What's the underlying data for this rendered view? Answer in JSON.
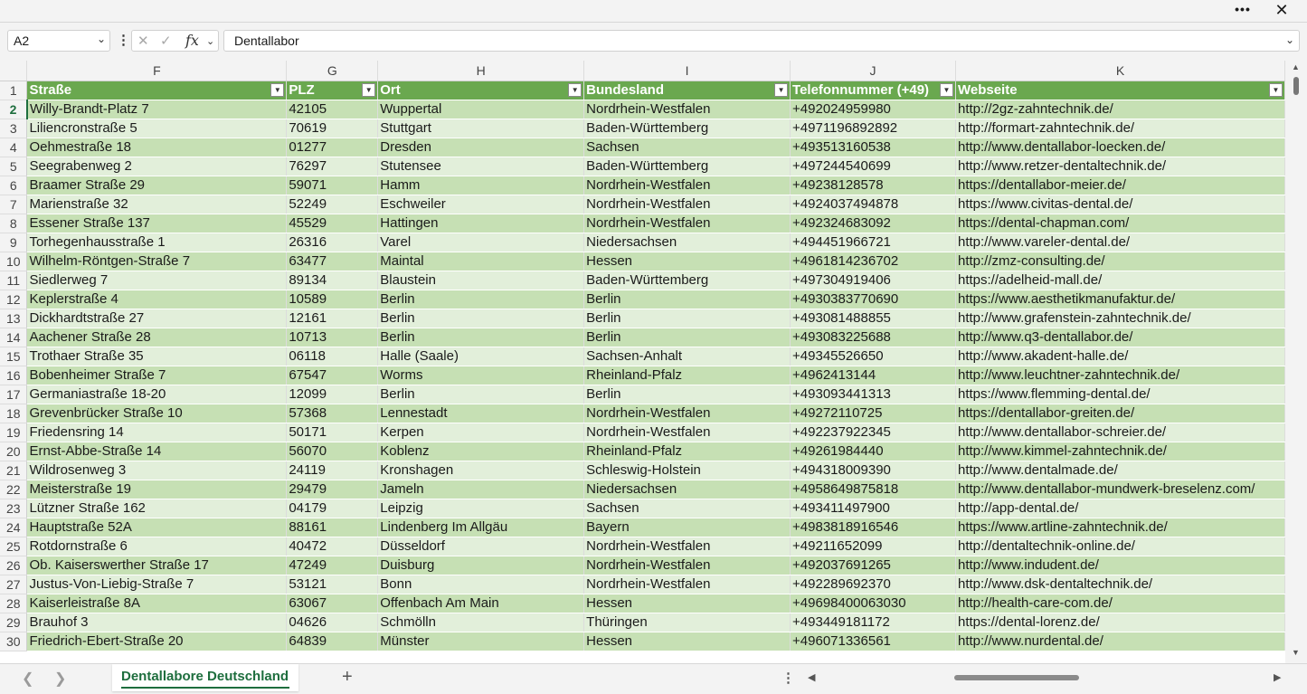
{
  "window": {
    "more_label": "•••",
    "close_label": "✕"
  },
  "formula_bar": {
    "name_box": "A2",
    "chevron": "⌄",
    "dots": "⋮",
    "cancel_icon": "✕",
    "enter_icon": "✓",
    "fx_label": "fx",
    "value": "Dentallabor"
  },
  "columns": [
    "F",
    "G",
    "H",
    "I",
    "J",
    "K"
  ],
  "headers": [
    "Straße",
    "PLZ",
    "Ort",
    "Bundesland",
    "Telefonnummer (+49)",
    "Webseite"
  ],
  "filter_icon": "▼",
  "active_row": "2",
  "rows": [
    {
      "n": "2",
      "cells": [
        "Willy-Brandt-Platz 7",
        "42105",
        "Wuppertal",
        "Nordrhein-Westfalen",
        "+492024959980",
        "http://2gz-zahntechnik.de/"
      ]
    },
    {
      "n": "3",
      "cells": [
        "Liliencronstraße 5",
        "70619",
        "Stuttgart",
        "Baden-Württemberg",
        "+4971196892892",
        "http://formart-zahntechnik.de/"
      ]
    },
    {
      "n": "4",
      "cells": [
        "Oehmestraße 18",
        "01277",
        "Dresden",
        "Sachsen",
        "+493513160538",
        "http://www.dentallabor-loecken.de/"
      ]
    },
    {
      "n": "5",
      "cells": [
        "Seegrabenweg 2",
        "76297",
        "Stutensee",
        "Baden-Württemberg",
        "+497244540699",
        "http://www.retzer-dentaltechnik.de/"
      ]
    },
    {
      "n": "6",
      "cells": [
        "Braamer Straße 29",
        "59071",
        "Hamm",
        "Nordrhein-Westfalen",
        "+49238128578",
        "https://dentallabor-meier.de/"
      ]
    },
    {
      "n": "7",
      "cells": [
        "Marienstraße 32",
        "52249",
        "Eschweiler",
        "Nordrhein-Westfalen",
        "+4924037494878",
        "https://www.civitas-dental.de/"
      ]
    },
    {
      "n": "8",
      "cells": [
        "Essener Straße 137",
        "45529",
        "Hattingen",
        "Nordrhein-Westfalen",
        "+492324683092",
        "https://dental-chapman.com/"
      ]
    },
    {
      "n": "9",
      "cells": [
        "Torhegenhausstraße 1",
        "26316",
        "Varel",
        "Niedersachsen",
        "+494451966721",
        "http://www.vareler-dental.de/"
      ]
    },
    {
      "n": "10",
      "cells": [
        "Wilhelm-Röntgen-Straße 7",
        "63477",
        "Maintal",
        "Hessen",
        "+4961814236702",
        "http://zmz-consulting.de/"
      ]
    },
    {
      "n": "11",
      "cells": [
        "Siedlerweg 7",
        "89134",
        "Blaustein",
        "Baden-Württemberg",
        "+497304919406",
        "https://adelheid-mall.de/"
      ]
    },
    {
      "n": "12",
      "cells": [
        "Keplerstraße 4",
        "10589",
        "Berlin",
        "Berlin",
        "+4930383770690",
        "https://www.aesthetikmanufaktur.de/"
      ]
    },
    {
      "n": "13",
      "cells": [
        "Dickhardtstraße 27",
        "12161",
        "Berlin",
        "Berlin",
        "+493081488855",
        "http://www.grafenstein-zahntechnik.de/"
      ]
    },
    {
      "n": "14",
      "cells": [
        "Aachener Straße 28",
        "10713",
        "Berlin",
        "Berlin",
        "+493083225688",
        "http://www.q3-dentallabor.de/"
      ]
    },
    {
      "n": "15",
      "cells": [
        "Trothaer Straße 35",
        "06118",
        "Halle (Saale)",
        "Sachsen-Anhalt",
        "+49345526650",
        "http://www.akadent-halle.de/"
      ]
    },
    {
      "n": "16",
      "cells": [
        "Bobenheimer Straße 7",
        "67547",
        "Worms",
        "Rheinland-Pfalz",
        "+4962413144",
        "http://www.leuchtner-zahntechnik.de/"
      ]
    },
    {
      "n": "17",
      "cells": [
        "Germaniastraße 18-20",
        "12099",
        "Berlin",
        "Berlin",
        "+493093441313",
        "https://www.flemming-dental.de/"
      ]
    },
    {
      "n": "18",
      "cells": [
        "Grevenbrücker Straße 10",
        "57368",
        "Lennestadt",
        "Nordrhein-Westfalen",
        "+49272110725",
        "https://dentallabor-greiten.de/"
      ]
    },
    {
      "n": "19",
      "cells": [
        "Friedensring 14",
        "50171",
        "Kerpen",
        "Nordrhein-Westfalen",
        "+492237922345",
        "http://www.dentallabor-schreier.de/"
      ]
    },
    {
      "n": "20",
      "cells": [
        "Ernst-Abbe-Straße 14",
        "56070",
        "Koblenz",
        "Rheinland-Pfalz",
        "+49261984440",
        "http://www.kimmel-zahntechnik.de/"
      ]
    },
    {
      "n": "21",
      "cells": [
        "Wildrosenweg 3",
        "24119",
        "Kronshagen",
        "Schleswig-Holstein",
        "+494318009390",
        "http://www.dentalmade.de/"
      ]
    },
    {
      "n": "22",
      "cells": [
        "Meisterstraße 19",
        "29479",
        "Jameln",
        "Niedersachsen",
        "+4958649875818",
        "http://www.dentallabor-mundwerk-breselenz.com/"
      ]
    },
    {
      "n": "23",
      "cells": [
        "Lützner Straße 162",
        "04179",
        "Leipzig",
        "Sachsen",
        "+493411497900",
        "http://app-dental.de/"
      ]
    },
    {
      "n": "24",
      "cells": [
        "Hauptstraße 52A",
        "88161",
        "Lindenberg Im Allgäu",
        "Bayern",
        "+4983818916546",
        "https://www.artline-zahntechnik.de/"
      ]
    },
    {
      "n": "25",
      "cells": [
        "Rotdornstraße 6",
        "40472",
        "Düsseldorf",
        "Nordrhein-Westfalen",
        "+49211652099",
        "http://dentaltechnik-online.de/"
      ]
    },
    {
      "n": "26",
      "cells": [
        "Ob. Kaiserswerther Straße 17",
        "47249",
        "Duisburg",
        "Nordrhein-Westfalen",
        "+492037691265",
        "http://www.indudent.de/"
      ]
    },
    {
      "n": "27",
      "cells": [
        "Justus-Von-Liebig-Straße 7",
        "53121",
        "Bonn",
        "Nordrhein-Westfalen",
        "+492289692370",
        "http://www.dsk-dentaltechnik.de/"
      ]
    },
    {
      "n": "28",
      "cells": [
        "Kaiserleistraße 8A",
        "63067",
        "Offenbach Am Main",
        "Hessen",
        "+49698400063030",
        "http://health-care-com.de/"
      ]
    },
    {
      "n": "29",
      "cells": [
        "Brauhof 3",
        "04626",
        "Schmölln",
        "Thüringen",
        "+493449181172",
        "https://dental-lorenz.de/"
      ]
    },
    {
      "n": "30",
      "cells": [
        "Friedrich-Ebert-Straße 20",
        "64839",
        "Münster",
        "Hessen",
        "+496071336561",
        "http://www.nurdental.de/"
      ]
    }
  ],
  "sheet_bar": {
    "prev_icon": "❮",
    "next_icon": "❯",
    "active_sheet": "Dentallabore Deutschland",
    "add_icon": "+",
    "dots": "⋮",
    "scroll_left": "◀",
    "scroll_right": "▶"
  },
  "vscroll": {
    "up": "▲",
    "down": "▼"
  }
}
